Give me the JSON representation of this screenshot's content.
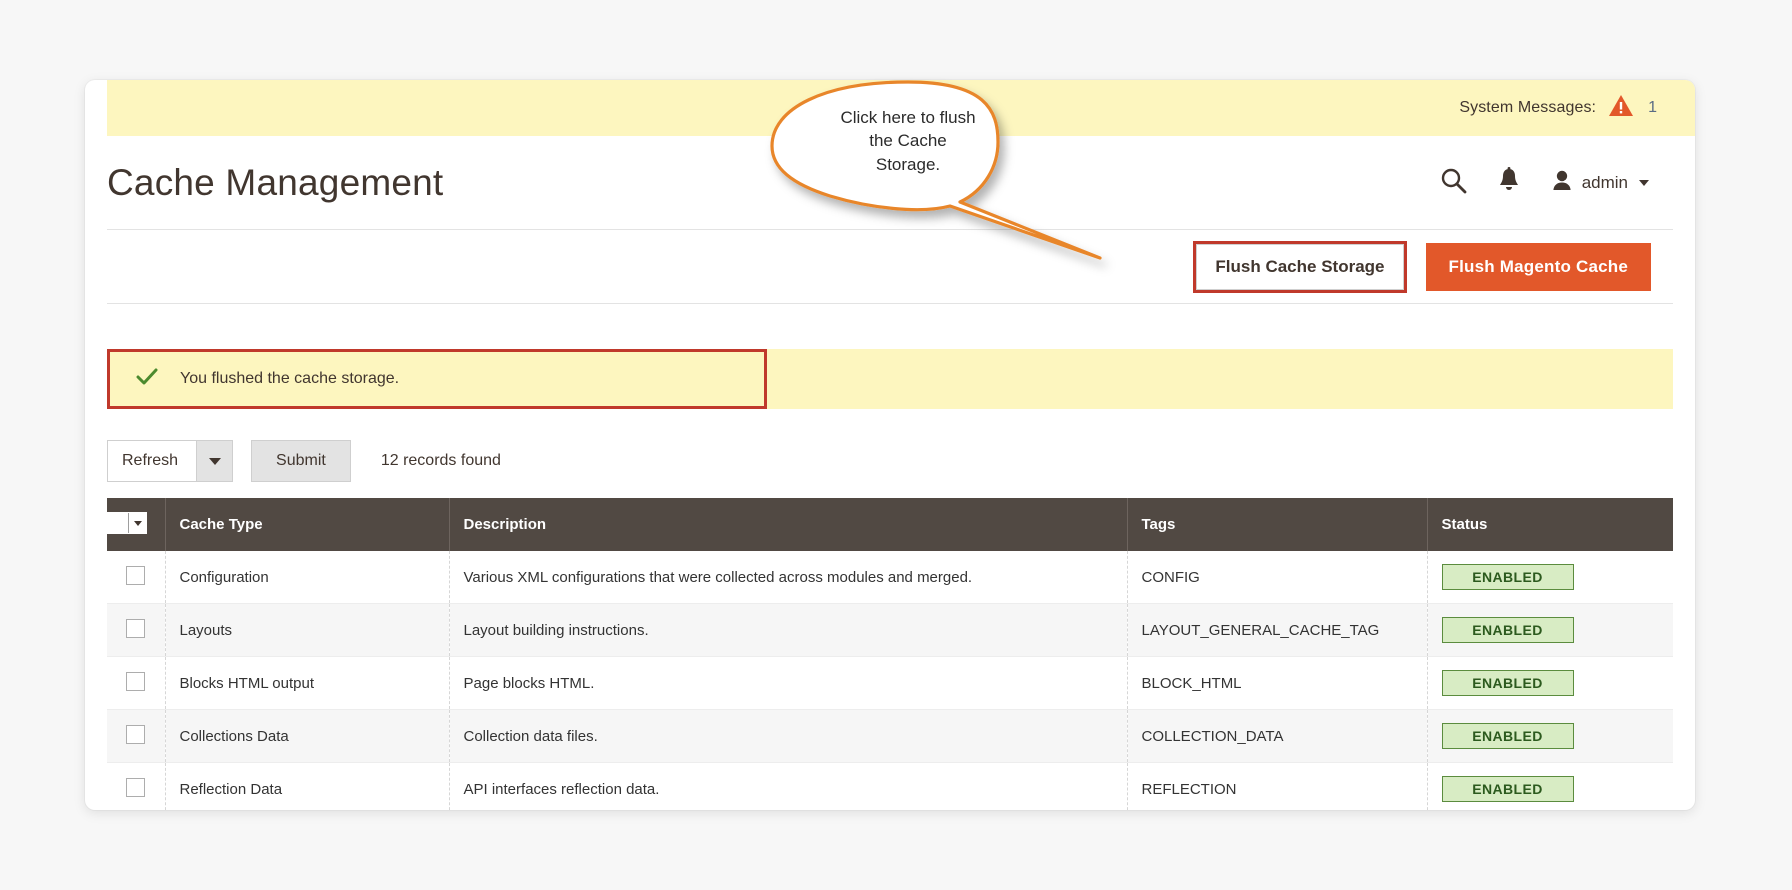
{
  "system_messages": {
    "label": "System Messages:",
    "count": "1",
    "icon": "warning-triangle-icon"
  },
  "header": {
    "title": "Cache Management",
    "search_icon": "search-icon",
    "notifications_icon": "bell-icon",
    "user_name": "admin",
    "user_icon": "user-avatar-icon",
    "caret_icon": "chevron-down-icon"
  },
  "actions": {
    "flush_cache_storage": "Flush Cache Storage",
    "flush_magento_cache": "Flush Magento Cache"
  },
  "callout": {
    "text": "Click here to flush the Cache Storage.",
    "line1": "Click here to flush",
    "line2": "the Cache",
    "line3": "Storage.",
    "color": "#e8862a"
  },
  "message": {
    "icon": "check-icon",
    "text": "You flushed the cache storage.",
    "highlight_color": "#c0392b",
    "background": "#fdf6bf"
  },
  "toolbar": {
    "action_select_value": "Refresh",
    "select_arrow_icon": "chevron-down-icon",
    "submit_label": "Submit",
    "records_found": "12 records found"
  },
  "grid": {
    "columns": [
      "",
      "Cache Type",
      "Description",
      "Tags",
      "Status"
    ],
    "select_all_icon": "checkbox-dropdown-icon",
    "rows": [
      {
        "cache_type": "Configuration",
        "description": "Various XML configurations that were collected across modules and merged.",
        "tags": "CONFIG",
        "status": "ENABLED"
      },
      {
        "cache_type": "Layouts",
        "description": "Layout building instructions.",
        "tags": "LAYOUT_GENERAL_CACHE_TAG",
        "status": "ENABLED"
      },
      {
        "cache_type": "Blocks HTML output",
        "description": "Page blocks HTML.",
        "tags": "BLOCK_HTML",
        "status": "ENABLED"
      },
      {
        "cache_type": "Collections Data",
        "description": "Collection data files.",
        "tags": "COLLECTION_DATA",
        "status": "ENABLED"
      },
      {
        "cache_type": "Reflection Data",
        "description": "API interfaces reflection data.",
        "tags": "REFLECTION",
        "status": "ENABLED"
      }
    ]
  },
  "theme": {
    "accent_orange": "#e2582a",
    "header_brown": "#514943",
    "message_yellow": "#fdf6bf",
    "badge_green_bg": "#d8ecc4",
    "badge_green_border": "#5b8c3e",
    "page_background": "#f7f7f7"
  }
}
